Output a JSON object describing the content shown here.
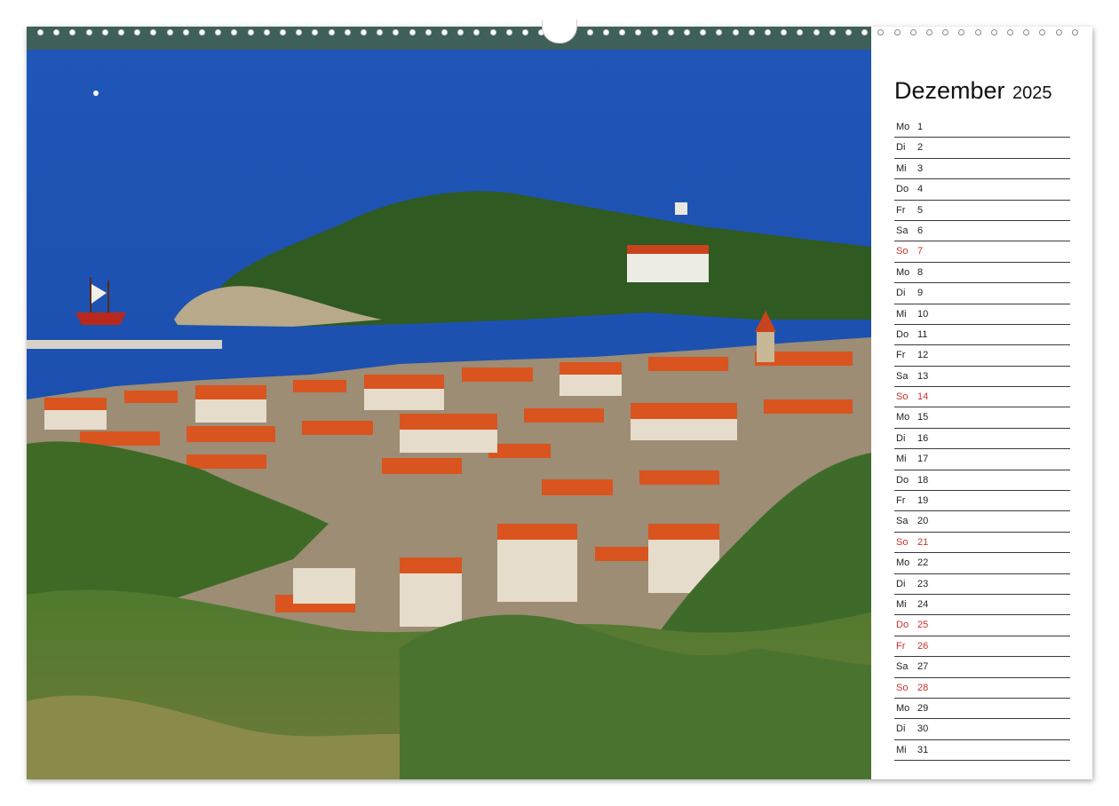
{
  "calendar": {
    "month": "Dezember",
    "year": "2025",
    "days": [
      {
        "weekday": "Mo",
        "day": "1",
        "highlight": false
      },
      {
        "weekday": "Di",
        "day": "2",
        "highlight": false
      },
      {
        "weekday": "Mi",
        "day": "3",
        "highlight": false
      },
      {
        "weekday": "Do",
        "day": "4",
        "highlight": false
      },
      {
        "weekday": "Fr",
        "day": "5",
        "highlight": false
      },
      {
        "weekday": "Sa",
        "day": "6",
        "highlight": false
      },
      {
        "weekday": "So",
        "day": "7",
        "highlight": true
      },
      {
        "weekday": "Mo",
        "day": "8",
        "highlight": false
      },
      {
        "weekday": "Di",
        "day": "9",
        "highlight": false
      },
      {
        "weekday": "Mi",
        "day": "10",
        "highlight": false
      },
      {
        "weekday": "Do",
        "day": "11",
        "highlight": false
      },
      {
        "weekday": "Fr",
        "day": "12",
        "highlight": false
      },
      {
        "weekday": "Sa",
        "day": "13",
        "highlight": false
      },
      {
        "weekday": "So",
        "day": "14",
        "highlight": true
      },
      {
        "weekday": "Mo",
        "day": "15",
        "highlight": false
      },
      {
        "weekday": "Di",
        "day": "16",
        "highlight": false
      },
      {
        "weekday": "Mi",
        "day": "17",
        "highlight": false
      },
      {
        "weekday": "Do",
        "day": "18",
        "highlight": false
      },
      {
        "weekday": "Fr",
        "day": "19",
        "highlight": false
      },
      {
        "weekday": "Sa",
        "day": "20",
        "highlight": false
      },
      {
        "weekday": "So",
        "day": "21",
        "highlight": true
      },
      {
        "weekday": "Mo",
        "day": "22",
        "highlight": false
      },
      {
        "weekday": "Di",
        "day": "23",
        "highlight": false
      },
      {
        "weekday": "Mi",
        "day": "24",
        "highlight": false
      },
      {
        "weekday": "Do",
        "day": "25",
        "highlight": true
      },
      {
        "weekday": "Fr",
        "day": "26",
        "highlight": true
      },
      {
        "weekday": "Sa",
        "day": "27",
        "highlight": false
      },
      {
        "weekday": "So",
        "day": "28",
        "highlight": true
      },
      {
        "weekday": "Mo",
        "day": "29",
        "highlight": false
      },
      {
        "weekday": "Di",
        "day": "30",
        "highlight": false
      },
      {
        "weekday": "Mi",
        "day": "31",
        "highlight": false
      }
    ]
  },
  "colors": {
    "holiday": "#c8322b",
    "sea": "#1f56b8",
    "roof": "#d9541f",
    "forest": "#3f6b2a"
  },
  "photo": {
    "subject": "coastal-town-photo"
  }
}
